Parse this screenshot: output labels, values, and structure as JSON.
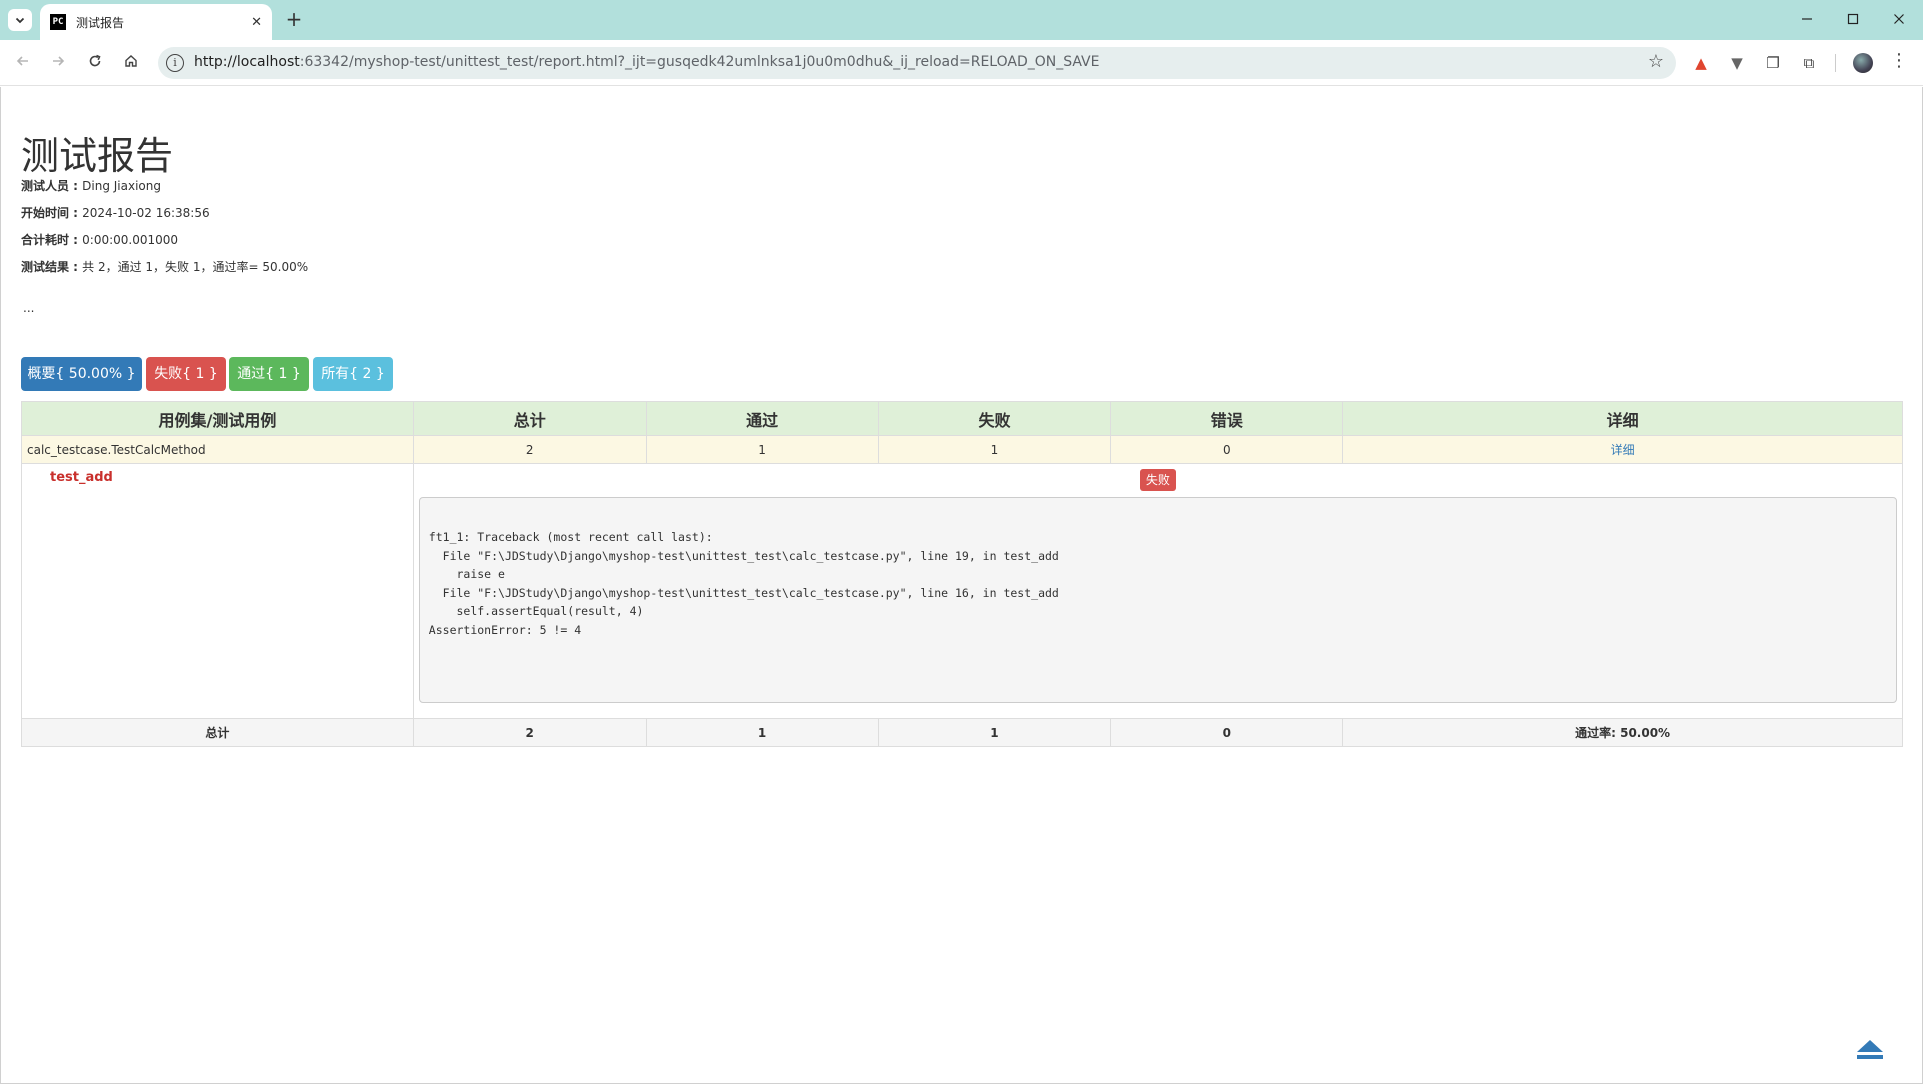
{
  "browser": {
    "tab_title": "测试报告",
    "tab_favicon": "PC",
    "url_host": "http://localhost",
    "url_rest": ":63342/myshop-test/unittest_test/report.html?_ijt=gusqedk42umlnksa1j0u0m0dhu&_ij_reload=RELOAD_ON_SAVE",
    "icons": {
      "tab_list": "chevron-down-icon",
      "back": "back-arrow-icon",
      "forward": "forward-arrow-icon",
      "reload": "reload-icon",
      "home": "home-icon"
    }
  },
  "report": {
    "title": "测试报告",
    "tester_label": "测试人员 : ",
    "tester": "Ding Jiaxiong",
    "start_label": "开始时间 : ",
    "start": "2024-10-02 16:38:56",
    "duration_label": "合计耗时 : ",
    "duration": "0:00:00.001000",
    "result_label": "测试结果 : ",
    "result": "共 2，通过 1，失败 1，通过率= 50.00%",
    "description": "..."
  },
  "filters": {
    "summary": "概要{ 50.00% }",
    "failed": "失败{ 1 }",
    "passed": "通过{ 1 }",
    "all": "所有{ 2 }"
  },
  "table": {
    "headers": [
      "用例集/测试用例",
      "总计",
      "通过",
      "失败",
      "错误",
      "详细"
    ],
    "suite": {
      "name": "calc_testcase.TestCalcMethod",
      "total": "2",
      "pass": "1",
      "fail": "1",
      "error": "0",
      "detail": "详细"
    },
    "case": {
      "name": "test_add",
      "status": "失败",
      "traceback": "ft1_1: Traceback (most recent call last):\n  File \"F:\\JDStudy\\Django\\myshop-test\\unittest_test\\calc_testcase.py\", line 19, in test_add\n    raise e\n  File \"F:\\JDStudy\\Django\\myshop-test\\unittest_test\\calc_testcase.py\", line 16, in test_add\n    self.assertEqual(result, 4)\nAssertionError: 5 != 4"
    },
    "totals": {
      "label": "总计",
      "total": "2",
      "pass": "1",
      "fail": "1",
      "error": "0",
      "rate": "通过率: 50.00%"
    }
  },
  "colors": {
    "primary": "#337ab7",
    "danger": "#d9534f",
    "success": "#5cb85c",
    "info": "#5bc0de",
    "header_bg": "#dff0d8",
    "suite_bg": "#fcf8e3"
  }
}
